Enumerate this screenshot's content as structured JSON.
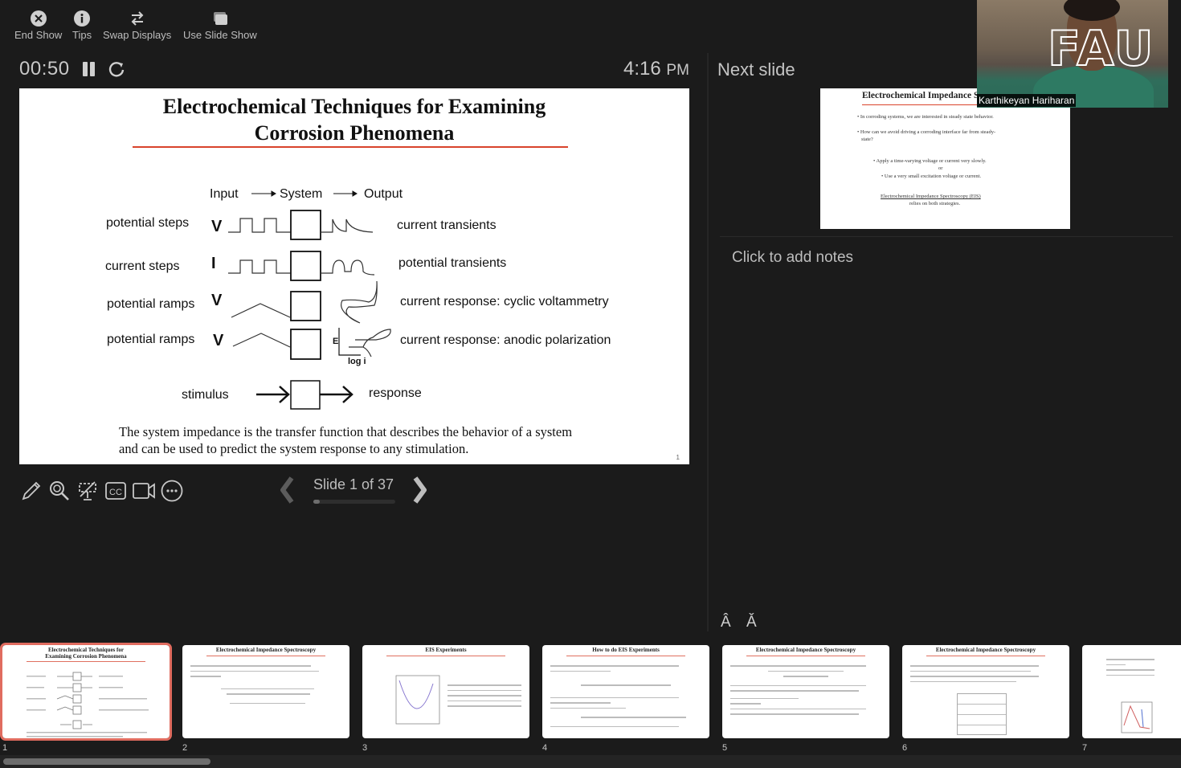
{
  "toolbar": {
    "end_show": "End Show",
    "tips": "Tips",
    "swap_displays": "Swap Displays",
    "use_slide_show": "Use Slide Show"
  },
  "timer": {
    "elapsed": "00:50"
  },
  "clock": {
    "time": "4:16",
    "meridiem": "PM"
  },
  "current_slide": {
    "title_line1": "Electrochemical Techniques for Examining",
    "title_line2": "Corrosion Phenomena",
    "diagram_header": {
      "input": "Input",
      "system": "System",
      "output": "Output"
    },
    "rows": [
      {
        "stimulus": "potential steps",
        "symbol": "V",
        "response": "current transients"
      },
      {
        "stimulus": "current steps",
        "symbol": "I",
        "response": "potential transients"
      },
      {
        "stimulus": "potential ramps",
        "symbol": "V",
        "response": "current response: cyclic voltammetry"
      },
      {
        "stimulus": "potential ramps",
        "symbol": "V",
        "response": "current response: anodic polarization"
      }
    ],
    "axis_e": "E",
    "axis_logi": "log i",
    "stimulus_label": "stimulus",
    "response_label": "response",
    "body_line1": "The system impedance is the transfer function that describes the behavior of a system",
    "body_line2": "and can be used to predict the system response to any stimulation.",
    "page_number": "1"
  },
  "navigation": {
    "counter": "Slide 1 of 37",
    "progress_fraction": 0.027
  },
  "next_slide": {
    "heading": "Next slide",
    "title": "Electrochemical Impedance Spectroscopy",
    "bullets": [
      "• In corroding systems, we are interested in steady state behavior.",
      "• How can we avoid driving a corroding interface far from steady-",
      "state?",
      "• Apply a time-varying voltage or current very slowly.",
      "or",
      "• Use a very small excitation voltage or current.",
      "Electrochemical Impedance Spectroscopy (EIS)",
      "relies on both strategies."
    ]
  },
  "notes": {
    "placeholder": "Click to add notes"
  },
  "font_controls": {
    "increase": "Â",
    "decrease": "Ǎ"
  },
  "video": {
    "participant_name": "Karthikeyan Hariharan",
    "logo_text": "FAU"
  },
  "filmstrip": {
    "accent_color": "#e06c5f",
    "slides": [
      {
        "number": "1",
        "title": "Electrochemical Techniques for Examining Corrosion Phenomena"
      },
      {
        "number": "2",
        "title": "Electrochemical Impedance Spectroscopy"
      },
      {
        "number": "3",
        "title": "EIS Experiments"
      },
      {
        "number": "4",
        "title": "How to do EIS Experiments"
      },
      {
        "number": "5",
        "title": "Electrochemical Impedance Spectroscopy"
      },
      {
        "number": "6",
        "title": "Electrochemical Impedance Spectroscopy"
      },
      {
        "number": "7",
        "title": ""
      }
    ]
  }
}
